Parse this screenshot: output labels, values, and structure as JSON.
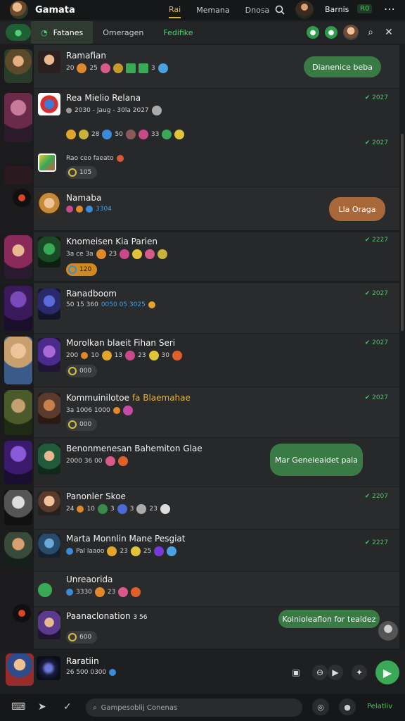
{
  "app": {
    "title": "Gamata"
  },
  "topnav": {
    "tabs": [
      "Rai",
      "Memana",
      "Dnosa"
    ],
    "profile_name": "Barnis",
    "badge": "R0"
  },
  "filter": {
    "tabs": [
      "Fatanes",
      "Omeragen",
      "Fedifike"
    ]
  },
  "rows": [
    {
      "name": "Ramafian",
      "stats": [
        "20",
        "25",
        "3"
      ],
      "time": "",
      "bubble": "Dianenice beba"
    },
    {
      "name": "Rea Mielio Relana",
      "stats": [
        "2030 - Jaug - 30la 2027"
      ],
      "time": "2027",
      "tag": "105",
      "time2": "2027",
      "extra_stats": "Rao ceo faeato"
    },
    {
      "name": "Namaba",
      "stats": [
        "3304"
      ],
      "bubble": "Lla Oraga"
    },
    {
      "name": "Knomeisen Kia Parien",
      "stats": [
        "3a ce 3a",
        "23"
      ],
      "time": "2227",
      "tag": "120"
    },
    {
      "name": "Ranadboom",
      "stats": [
        "50 15 360",
        "0050 05 3025"
      ],
      "time": "2027"
    },
    {
      "name": "Morolkan blaeit Fihan Seri",
      "stats": [
        "200",
        "10",
        "13",
        "23",
        "30"
      ],
      "time": "2027",
      "tag": "000"
    },
    {
      "name": "Kommuinilotoe",
      "name_hl": "fa Blaemahae",
      "stats": [
        "3a 1006 1000"
      ],
      "time": "2027",
      "tag": "000"
    },
    {
      "name": "Benonmenesan Bahemiton Glae",
      "stats": [
        "2000 36 00"
      ],
      "bubble": "Mar Geneieaidet pala"
    },
    {
      "name": "Panonler Skoe",
      "stats": [
        "24",
        "10",
        "3",
        "3",
        "23"
      ],
      "time": "2207"
    },
    {
      "name": "Marta Monnlin Mane Pesgiat",
      "stats": [
        "Pal laaoo",
        "23",
        "25"
      ],
      "time": "2227"
    },
    {
      "name": "Unreaorida",
      "stats": [
        "3330",
        "23"
      ]
    },
    {
      "name": "Paanaclonation",
      "name_tail": "3 56",
      "tag": "600",
      "bubble": "Kolnioleaflon for tealdez"
    }
  ],
  "composer": {
    "name": "Raratiin",
    "stats": "26 500 0300"
  },
  "bottom": {
    "placeholder": "Gampesoblij Conenas",
    "action": "Pelatliv"
  },
  "colors": {
    "accent_green": "#3aa955",
    "bubble_green": "#3a7a45",
    "bubble_brown": "#a8683a",
    "gold": "#e0b23d"
  }
}
